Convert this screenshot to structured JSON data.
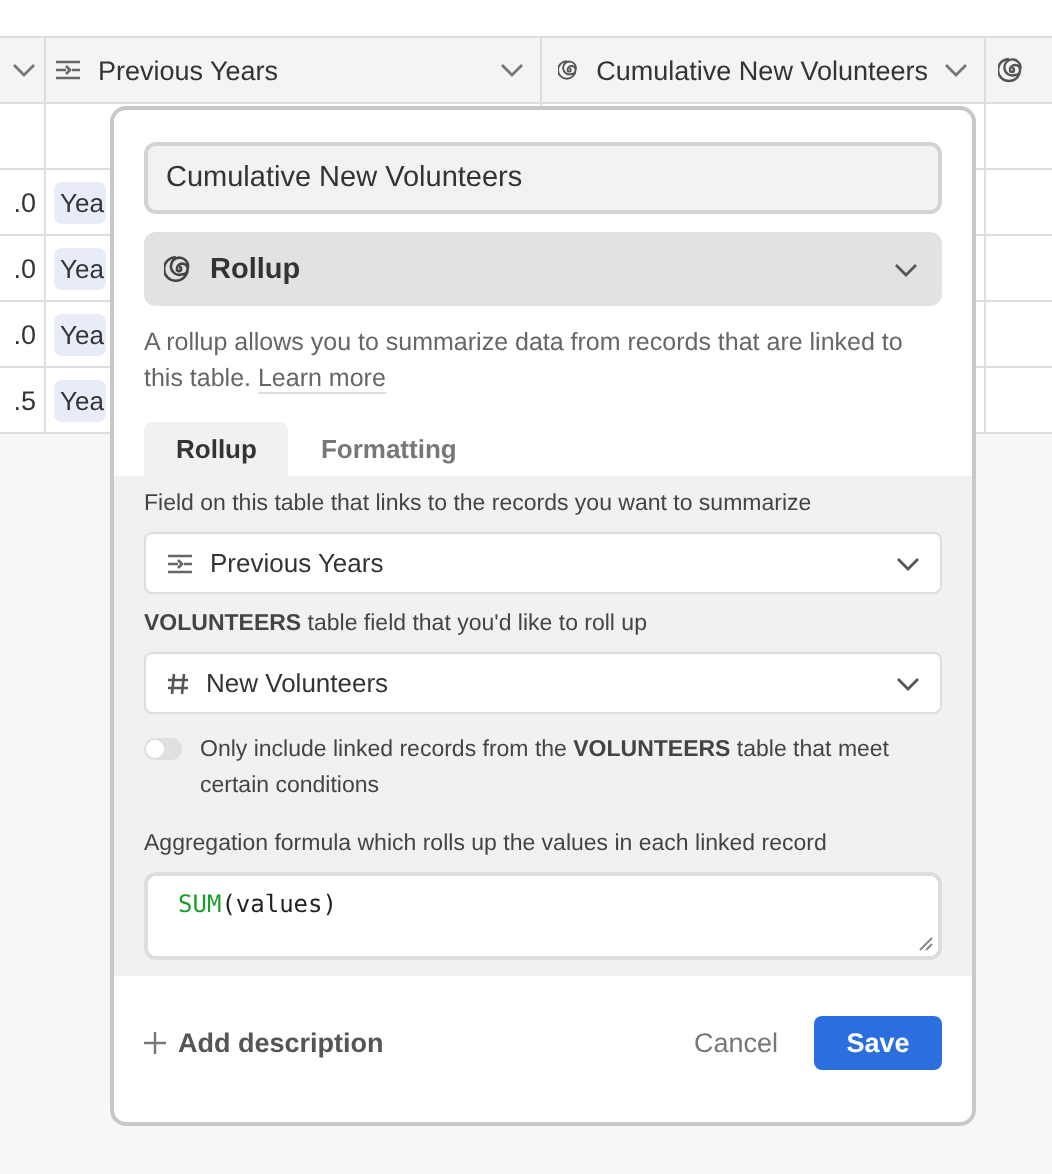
{
  "table": {
    "columns": [
      {
        "kind": "plain"
      },
      {
        "label": "Previous Years",
        "kind": "link"
      },
      {
        "label": "Cumulative New Volunteers",
        "kind": "rollup"
      },
      {
        "kind": "rollup"
      }
    ],
    "rows": [
      {
        "value": "",
        "chip": ""
      },
      {
        "value": ".0",
        "chip": "Yea"
      },
      {
        "value": ".0",
        "chip": "Yea"
      },
      {
        "value": ".0",
        "chip": "Yea"
      },
      {
        "value": ".5",
        "chip": "Yea"
      }
    ]
  },
  "dialog": {
    "name_value": "Cumulative New Volunteers",
    "field_type": "Rollup",
    "description": "A rollup allows you to summarize data from records that are linked to this table.",
    "learn_more": "Learn more",
    "tabs": [
      {
        "label": "Rollup",
        "selected": true
      },
      {
        "label": "Formatting",
        "selected": false
      }
    ],
    "link_label": "Field on this table that links to the records you want to summarize",
    "link_field": "Previous Years",
    "rollup_label": "**VOLUNTEERS** table field that you'd like to roll up",
    "rollup_field": "New Volunteers",
    "filter_toggle": {
      "on": false,
      "label": "Only include linked records from the **VOLUNTEERS** table that meet certain conditions"
    },
    "formula_label": "Aggregation formula which rolls up the values in each linked record",
    "formula_function": "SUM",
    "formula_args": "(values)",
    "add_description": "Add description",
    "cancel": "Cancel",
    "save": "Save"
  }
}
